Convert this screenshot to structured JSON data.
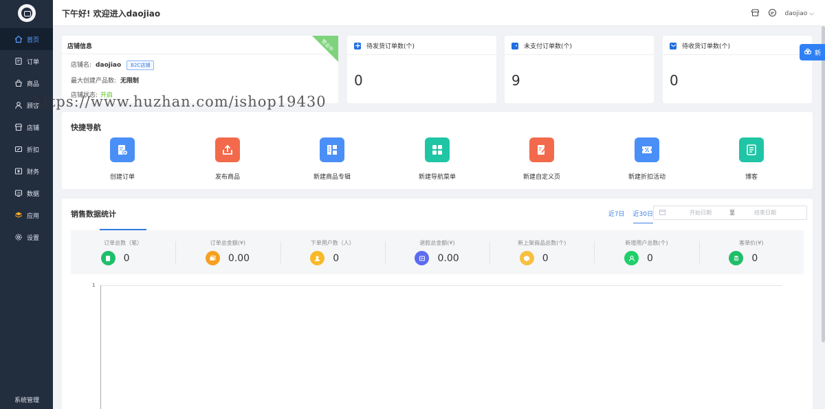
{
  "header": {
    "greeting": "下午好! 欢迎进入daojiao",
    "username": "daojiao"
  },
  "sidebar": {
    "items": [
      {
        "label": "首页",
        "icon": "home-icon",
        "active": true
      },
      {
        "label": "订单",
        "icon": "order-icon"
      },
      {
        "label": "商品",
        "icon": "bag-icon"
      },
      {
        "label": "顾客",
        "icon": "user-icon"
      },
      {
        "label": "店铺",
        "icon": "store-icon"
      },
      {
        "label": "折扣",
        "icon": "coupon-icon"
      },
      {
        "label": "财务",
        "icon": "finance-icon"
      },
      {
        "label": "数据",
        "icon": "data-icon"
      },
      {
        "label": "应用",
        "icon": "app-icon"
      },
      {
        "label": "设置",
        "icon": "gear-icon"
      }
    ],
    "system": "系统管理"
  },
  "store": {
    "title": "店铺信息",
    "ribbon": "营业中",
    "name_label": "店铺名:",
    "name": "daojiao",
    "type_tag": "B2C店铺",
    "limit_label": "最大创建产品数:",
    "limit": "无限制",
    "status_label": "店铺状态:",
    "status": "开启"
  },
  "stats": [
    {
      "label": "待发货订单数(个)",
      "value": "0",
      "color": "#1f6fe0"
    },
    {
      "label": "未支付订单数(个)",
      "value": "9",
      "color": "#1f6fe0"
    },
    {
      "label": "待收货订单数(个)",
      "value": "0",
      "color": "#1f6fe0"
    }
  ],
  "quick_nav": {
    "title": "快捷导航",
    "items": [
      {
        "label": "创建订单",
        "color": "#4a8ff7",
        "icon": "create-order-icon"
      },
      {
        "label": "发布商品",
        "color": "#f26a4b",
        "icon": "upload-icon"
      },
      {
        "label": "新建商品专辑",
        "color": "#4a8ff7",
        "icon": "album-icon"
      },
      {
        "label": "新建导航菜单",
        "color": "#1fc5a5",
        "icon": "menu-grid-icon"
      },
      {
        "label": "新建自定义页",
        "color": "#f26a4b",
        "icon": "edit-page-icon"
      },
      {
        "label": "新建折扣活动",
        "color": "#4a8ff7",
        "icon": "discount-icon"
      },
      {
        "label": "博客",
        "color": "#1fc5a5",
        "icon": "blog-icon"
      }
    ]
  },
  "sales": {
    "title": "销售数据统计",
    "tab_7": "近7日",
    "tab_30": "近30日",
    "start_placeholder": "开始日期",
    "to": "至",
    "end_placeholder": "结束日期",
    "metrics": [
      {
        "label": "订单总数（笔）",
        "value": "0",
        "color": "#1fbf6a"
      },
      {
        "label": "订单总金额(¥)",
        "value": "0.00",
        "color": "#f5a020"
      },
      {
        "label": "下单用户数（人）",
        "value": "0",
        "color": "#f7b928"
      },
      {
        "label": "退款总金额(¥)",
        "value": "0.00",
        "color": "#5b6cf0"
      },
      {
        "label": "新上架商品总数(个)",
        "value": "0",
        "color": "#f7c040"
      },
      {
        "label": "新增用户总数(个)",
        "value": "0",
        "color": "#1fcf6a"
      },
      {
        "label": "客单价(¥)",
        "value": "0",
        "color": "#1fbf6a"
      }
    ],
    "y_tick": "1"
  },
  "watermark": "https://www.huzhan.com/ishop19430",
  "float_button": "新"
}
